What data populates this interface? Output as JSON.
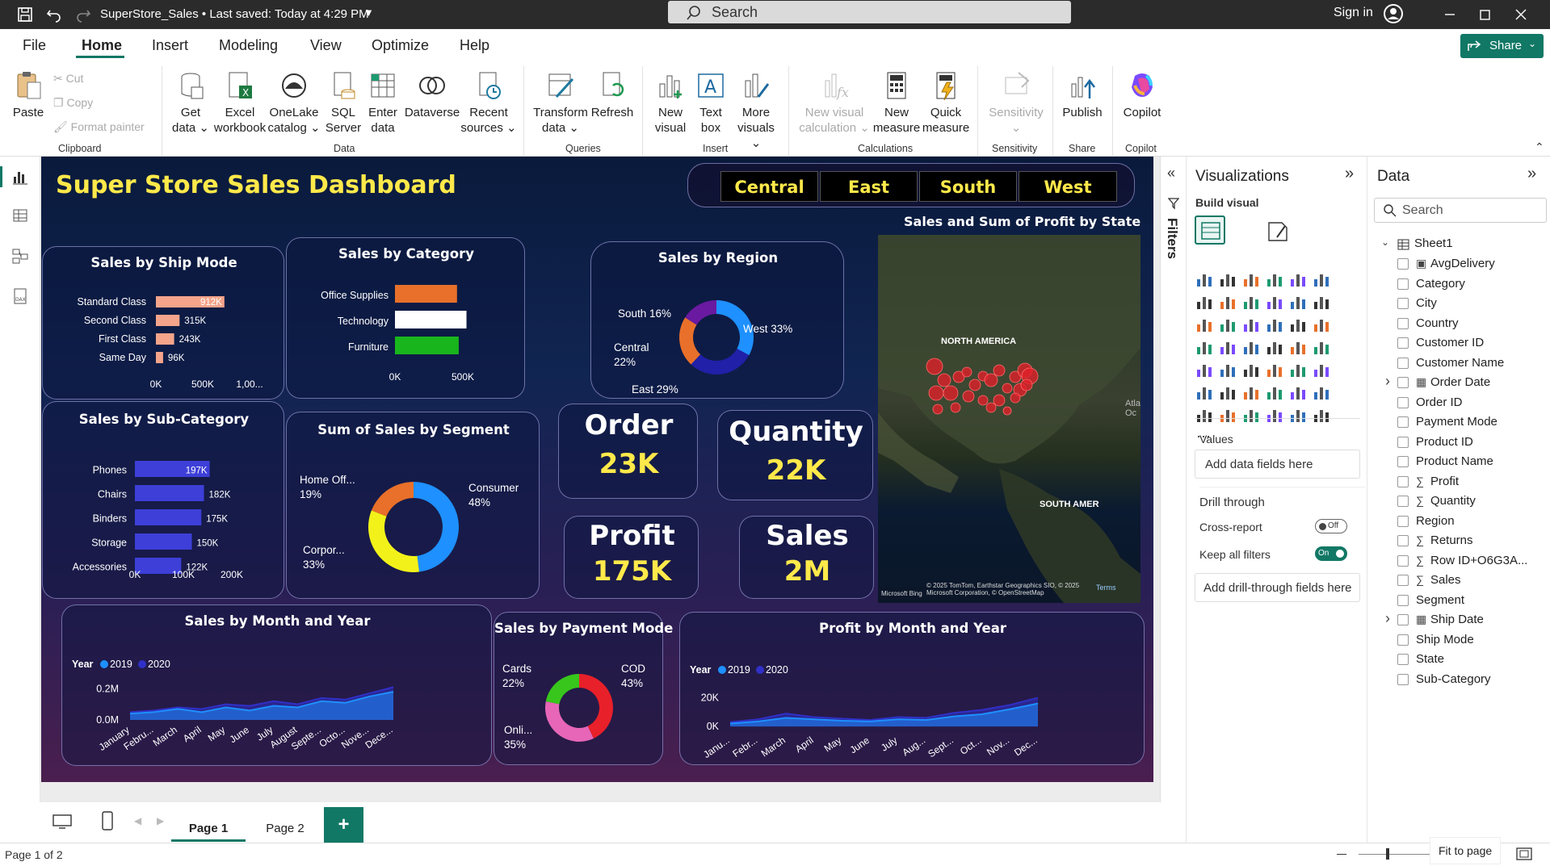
{
  "window": {
    "title": "SuperStore_Sales • Last saved: Today at 4:29 PM",
    "search_placeholder": "Search",
    "sign_in": "Sign in"
  },
  "menu": {
    "items": [
      "File",
      "Home",
      "Insert",
      "Modeling",
      "View",
      "Optimize",
      "Help"
    ],
    "active": "Home",
    "share": "Share"
  },
  "ribbon": {
    "clipboard": {
      "paste": "Paste",
      "cut": "Cut",
      "copy": "Copy",
      "format_painter": "Format painter",
      "group": "Clipboard"
    },
    "data": {
      "items": [
        {
          "l1": "Get",
          "l2": "data ⌄"
        },
        {
          "l1": "Excel",
          "l2": "workbook"
        },
        {
          "l1": "OneLake",
          "l2": "catalog ⌄"
        },
        {
          "l1": "SQL",
          "l2": "Server"
        },
        {
          "l1": "Enter",
          "l2": "data"
        },
        {
          "l1": "Dataverse",
          "l2": ""
        },
        {
          "l1": "Recent",
          "l2": "sources ⌄"
        }
      ],
      "group": "Data"
    },
    "queries": {
      "items": [
        {
          "l1": "Transform",
          "l2": "data ⌄"
        },
        {
          "l1": "Refresh",
          "l2": ""
        }
      ],
      "group": "Queries"
    },
    "insert": {
      "items": [
        {
          "l1": "New",
          "l2": "visual"
        },
        {
          "l1": "Text",
          "l2": "box"
        },
        {
          "l1": "More",
          "l2": "visuals ⌄"
        }
      ],
      "group": "Insert"
    },
    "calculations": {
      "items": [
        {
          "l1": "New visual",
          "l2": "calculation ⌄"
        },
        {
          "l1": "New",
          "l2": "measure"
        },
        {
          "l1": "Quick",
          "l2": "measure"
        }
      ],
      "group": "Calculations"
    },
    "sensitivity": {
      "l1": "Sensitivity",
      "l2": "⌄",
      "group": "Sensitivity"
    },
    "share": {
      "l1": "Publish",
      "group": "Share"
    },
    "copilot": {
      "l1": "Copilot",
      "group": "Copilot"
    }
  },
  "report": {
    "title": "Super Store Sales Dashboard",
    "regions": [
      "Central",
      "East",
      "South",
      "West"
    ],
    "kpis": {
      "order_label": "Order",
      "order_value": "23K",
      "quantity_label": "Quantity",
      "quantity_value": "22K",
      "profit_label": "Profit",
      "profit_value": "175K",
      "sales_label": "Sales",
      "sales_value": "2M"
    },
    "map": {
      "title": "Sales and Sum of Profit by State",
      "label_na": "NORTH AMERICA",
      "label_sa": "SOUTH AMER",
      "label_atl": "Atla\nOc",
      "credit": "© 2025 TomTom, Earthstar Geographics SIO, © 2025 Microsoft Corporation, © OpenStreetMap",
      "terms": "Terms",
      "bing": "Microsoft Bing"
    }
  },
  "chart_data": [
    {
      "type": "bar",
      "title": "Sales by Ship Mode",
      "orientation": "horizontal",
      "categories": [
        "Standard Class",
        "Second Class",
        "First Class",
        "Same Day"
      ],
      "values": [
        912000,
        315000,
        243000,
        96000
      ],
      "data_labels": [
        "912K",
        "315K",
        "243K",
        "96K"
      ],
      "xticks": [
        "0K",
        "500K",
        "1,00..."
      ],
      "xlim": [
        0,
        1000000
      ],
      "color": "#f4a48a"
    },
    {
      "type": "bar",
      "title": "Sales by Category",
      "orientation": "horizontal",
      "categories": [
        "Office Supplies",
        "Technology",
        "Furniture"
      ],
      "values": [
        720000,
        830000,
        740000
      ],
      "xticks": [
        "0K",
        "500K"
      ],
      "xlim": [
        0,
        900000
      ],
      "colors": [
        "#e8702a",
        "#ffffff",
        "#19b51c"
      ]
    },
    {
      "type": "pie",
      "title": "Sales by Region",
      "donut": true,
      "labels": [
        "West",
        "East",
        "Central",
        "South"
      ],
      "values": [
        33,
        29,
        22,
        16
      ],
      "data_labels": [
        "West 33%",
        "East 29%",
        "Central 22%",
        "South 16%"
      ],
      "colors": [
        "#1e90ff",
        "#2020a8",
        "#e8702a",
        "#6a1aa0"
      ]
    },
    {
      "type": "bar",
      "title": "Sales by Sub-Category",
      "orientation": "horizontal",
      "categories": [
        "Phones",
        "Chairs",
        "Binders",
        "Storage",
        "Accessories"
      ],
      "values": [
        197000,
        182000,
        175000,
        150000,
        122000
      ],
      "data_labels": [
        "197K",
        "182K",
        "175K",
        "150K",
        "122K"
      ],
      "xticks": [
        "0K",
        "100K",
        "200K"
      ],
      "xlim": [
        0,
        200000
      ],
      "color": "#3d3fd8"
    },
    {
      "type": "pie",
      "title": "Sum of Sales by Segment",
      "donut": true,
      "labels": [
        "Consumer",
        "Corporate",
        "Home Office"
      ],
      "values": [
        48,
        33,
        19
      ],
      "data_labels": [
        "Consumer 48%",
        "Corpor... 33%",
        "Home Off... 19%"
      ],
      "colors": [
        "#1e90ff",
        "#f2f21a",
        "#e8702a"
      ]
    },
    {
      "type": "pie",
      "title": "Sales by Payment Mode",
      "donut": true,
      "labels": [
        "COD",
        "Online",
        "Cards"
      ],
      "values": [
        43,
        35,
        22
      ],
      "data_labels": [
        "COD 43%",
        "Onli... 35%",
        "Cards 22%"
      ],
      "colors": [
        "#e8202a",
        "#e766b8",
        "#38c51c"
      ]
    },
    {
      "type": "area",
      "title": "Sales by Month and Year",
      "legend_title": "Year",
      "legend_position": "top-left",
      "categories": [
        "January",
        "Febru...",
        "March",
        "April",
        "May",
        "June",
        "July",
        "August",
        "Septe...",
        "Octo...",
        "Nove...",
        "Dece..."
      ],
      "yticks": [
        "0.0M",
        "0.2M"
      ],
      "ylim": [
        0,
        0.32
      ],
      "series": [
        {
          "name": "2019",
          "color": "#1e90ff",
          "values": [
            0.04,
            0.05,
            0.07,
            0.05,
            0.08,
            0.06,
            0.09,
            0.08,
            0.12,
            0.11,
            0.15,
            0.18
          ]
        },
        {
          "name": "2020",
          "color": "#3030c8",
          "values": [
            0.05,
            0.06,
            0.08,
            0.07,
            0.1,
            0.09,
            0.12,
            0.1,
            0.14,
            0.13,
            0.17,
            0.21
          ]
        }
      ]
    },
    {
      "type": "area",
      "title": "Profit by Month and Year",
      "legend_title": "Year",
      "legend_position": "top-left",
      "categories": [
        "Janu...",
        "Febr...",
        "March",
        "April",
        "May",
        "June",
        "July",
        "Aug...",
        "Sept...",
        "Oct...",
        "Nov...",
        "Dec..."
      ],
      "yticks": [
        "0K",
        "20K"
      ],
      "ylim": [
        -5000,
        40000
      ],
      "series": [
        {
          "name": "2019",
          "color": "#1e90ff",
          "values": [
            2000,
            3500,
            6000,
            5000,
            4000,
            3500,
            5000,
            4500,
            7000,
            8500,
            12000,
            16000
          ]
        },
        {
          "name": "2020",
          "color": "#3030c8",
          "values": [
            3000,
            5000,
            9000,
            6500,
            5500,
            4500,
            6500,
            6000,
            9500,
            11500,
            15000,
            20000
          ]
        }
      ]
    }
  ],
  "filters": {
    "label": "Filters"
  },
  "visualizations": {
    "title": "Visualizations",
    "build_visual": "Build visual",
    "values_label": "Values",
    "values_placeholder": "Add data fields here",
    "drill_through": "Drill through",
    "cross_report": "Cross-report",
    "cross_report_state": "Off",
    "keep_filters": "Keep all filters",
    "keep_filters_state": "On",
    "drill_placeholder": "Add drill-through fields here"
  },
  "data_pane": {
    "title": "Data",
    "search_placeholder": "Search",
    "table": "Sheet1",
    "fields": [
      {
        "name": "AvgDelivery",
        "icon": "calculator"
      },
      {
        "name": "Category",
        "icon": ""
      },
      {
        "name": "City",
        "icon": ""
      },
      {
        "name": "Country",
        "icon": ""
      },
      {
        "name": "Customer ID",
        "icon": ""
      },
      {
        "name": "Customer Name",
        "icon": ""
      },
      {
        "name": "Order Date",
        "icon": "table",
        "expand": true
      },
      {
        "name": "Order ID",
        "icon": ""
      },
      {
        "name": "Payment Mode",
        "icon": ""
      },
      {
        "name": "Product ID",
        "icon": ""
      },
      {
        "name": "Product Name",
        "icon": ""
      },
      {
        "name": "Profit",
        "icon": "sigma"
      },
      {
        "name": "Quantity",
        "icon": "sigma"
      },
      {
        "name": "Region",
        "icon": ""
      },
      {
        "name": "Returns",
        "icon": "sigma"
      },
      {
        "name": "Row ID+O6G3A...",
        "icon": "sigma"
      },
      {
        "name": "Sales",
        "icon": "sigma"
      },
      {
        "name": "Segment",
        "icon": ""
      },
      {
        "name": "Ship Date",
        "icon": "table",
        "expand": true
      },
      {
        "name": "Ship Mode",
        "icon": ""
      },
      {
        "name": "State",
        "icon": ""
      },
      {
        "name": "Sub-Category",
        "icon": ""
      }
    ]
  },
  "pages": {
    "tabs": [
      "Page 1",
      "Page 2"
    ],
    "active": "Page 1",
    "add": "+"
  },
  "status": {
    "page_info": "Page 1 of 2",
    "fit": "Fit to page"
  }
}
